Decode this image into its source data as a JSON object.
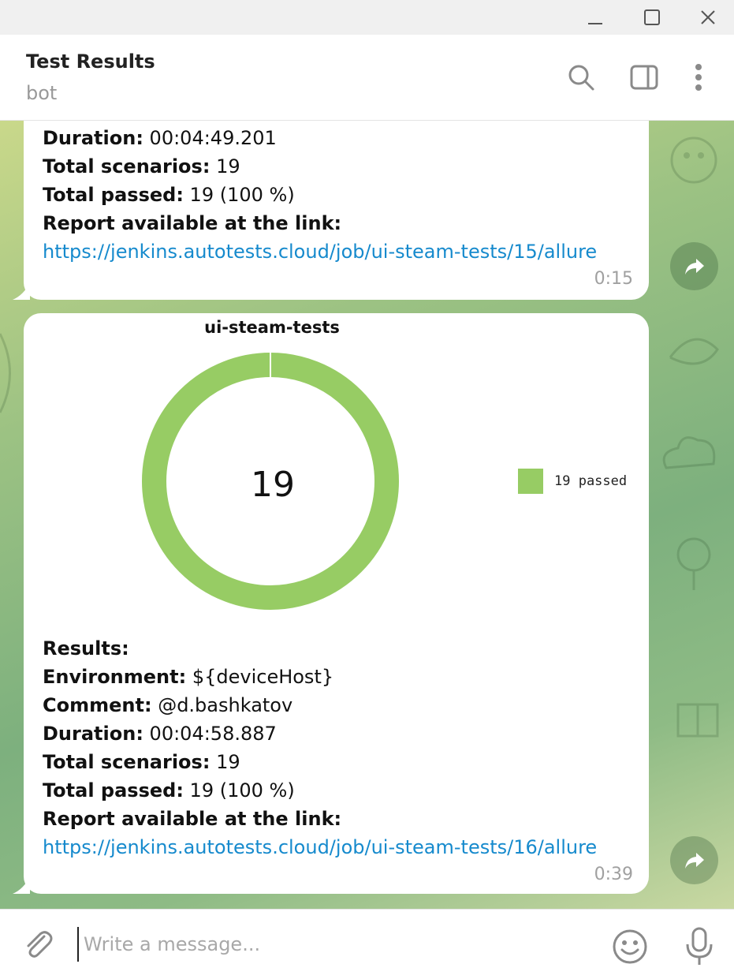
{
  "window": {
    "controls": [
      "minimize-icon",
      "maximize-icon",
      "close-icon"
    ]
  },
  "header": {
    "title": "Test Results",
    "subtitle": "bot",
    "icons": [
      "search-icon",
      "sidebar-toggle-icon",
      "more-vertical-icon"
    ]
  },
  "messages": [
    {
      "lines": [
        {
          "label": "Duration:",
          "value": " 00:04:49.201"
        },
        {
          "label": "Total scenarios:",
          "value": " 19"
        },
        {
          "label": "Total passed:",
          "value": " 19 (100 %)"
        },
        {
          "label": "Report available at the link:",
          "value": ""
        }
      ],
      "link": "https://jenkins.autotests.cloud/job/ui-steam-tests/15/allure",
      "time": "0:15"
    },
    {
      "chart_title": "ui-steam-tests",
      "chart_center": "19",
      "legend_label": "19 passed",
      "results_label": "Results:",
      "lines": [
        {
          "label": "Environment:",
          "value": " ${deviceHost}"
        },
        {
          "label": "Comment:",
          "value": " @d.bashkatov"
        },
        {
          "label": "Duration:",
          "value": " 00:04:58.887"
        },
        {
          "label": "Total scenarios:",
          "value": " 19"
        },
        {
          "label": "Total passed:",
          "value": " 19 (100 %)"
        },
        {
          "label": "Report available at the link:",
          "value": ""
        }
      ],
      "link": "https://jenkins.autotests.cloud/job/ui-steam-tests/16/allure",
      "time": "0:39"
    }
  ],
  "chart_data": {
    "type": "pie",
    "title": "ui-steam-tests",
    "center_label": "19",
    "categories": [
      "19 passed"
    ],
    "values": [
      19
    ],
    "colors": [
      "#97cc64"
    ],
    "legend": "right"
  },
  "composer": {
    "placeholder": "Write a message...",
    "icons": [
      "paperclip-icon",
      "emoji-icon",
      "microphone-icon"
    ]
  },
  "colors": {
    "link": "#168acd",
    "passed": "#97cc64",
    "bubble": "#ffffff"
  }
}
